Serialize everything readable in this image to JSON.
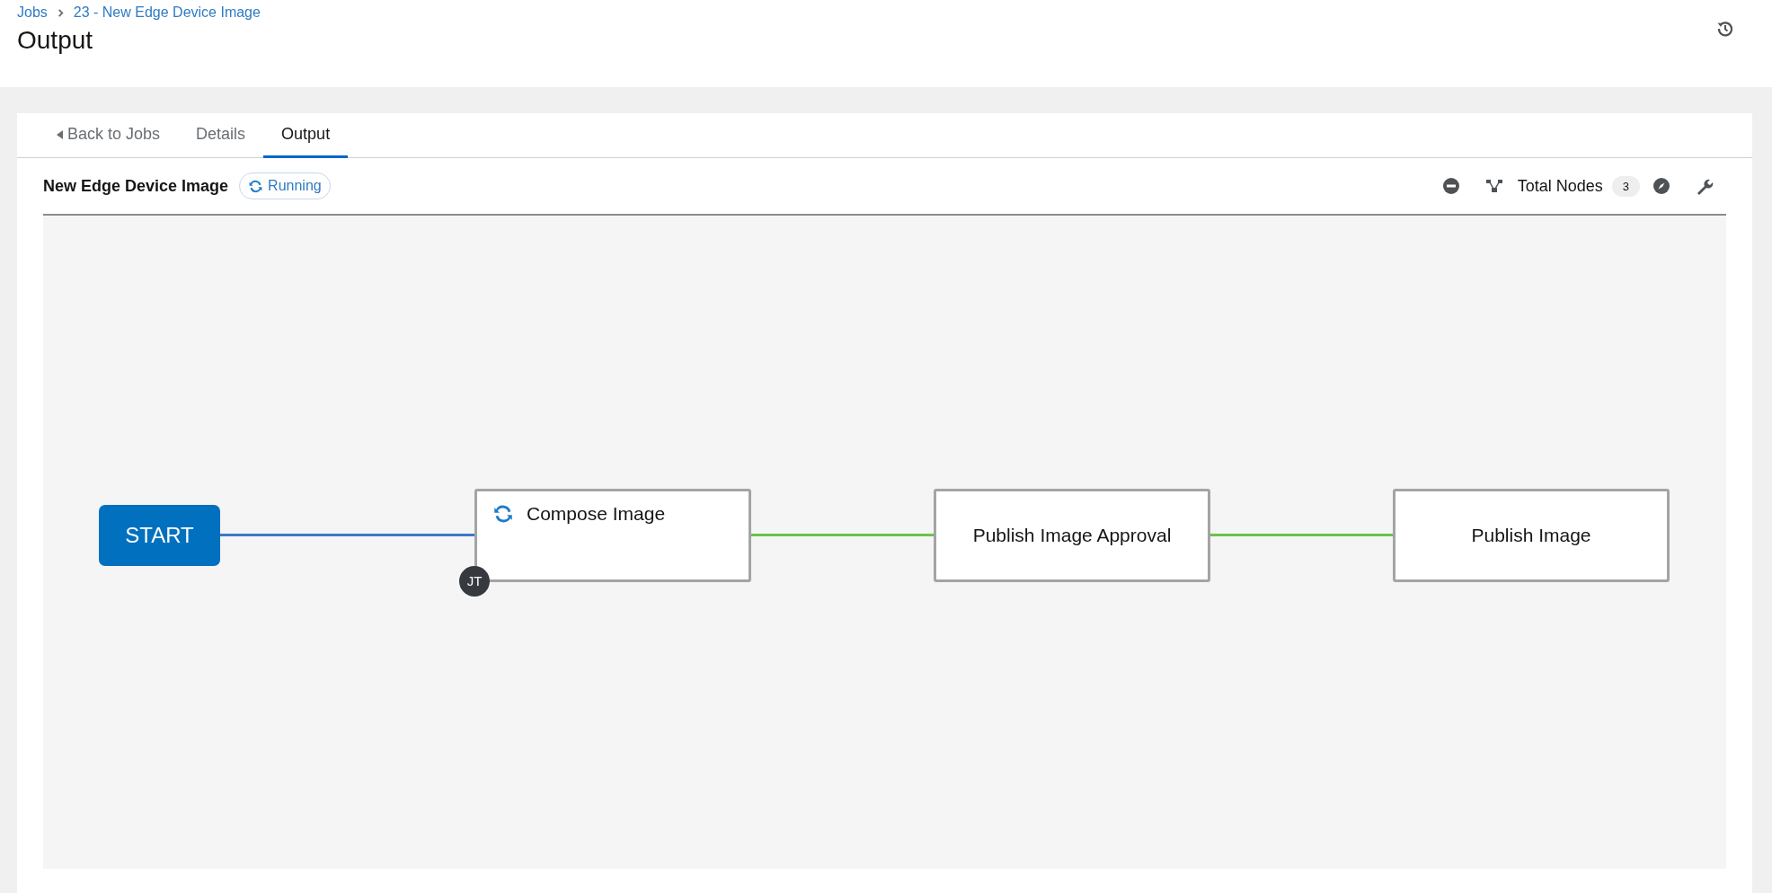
{
  "breadcrumbs": [
    {
      "label": "Jobs"
    },
    {
      "label": "23 - New Edge Device Image"
    }
  ],
  "page_title": "Output",
  "tabs": [
    {
      "label": "Back to Jobs",
      "kind": "back",
      "selected": false
    },
    {
      "label": "Details",
      "kind": "tab",
      "selected": false
    },
    {
      "label": "Output",
      "kind": "tab",
      "selected": true
    }
  ],
  "workflow": {
    "name": "New Edge Device Image",
    "status": "Running"
  },
  "toolbar": {
    "total_nodes_label": "Total Nodes",
    "total_nodes": "3"
  },
  "graph": {
    "start_label": "START",
    "nodes": [
      {
        "label": "Compose Image",
        "running": true,
        "badge": "JT"
      },
      {
        "label": "Publish Image Approval",
        "running": false
      },
      {
        "label": "Publish Image",
        "running": false
      }
    ],
    "links": [
      {
        "color": "#3e78c8"
      },
      {
        "color": "#6cc24a"
      },
      {
        "color": "#6cc24a"
      }
    ]
  }
}
